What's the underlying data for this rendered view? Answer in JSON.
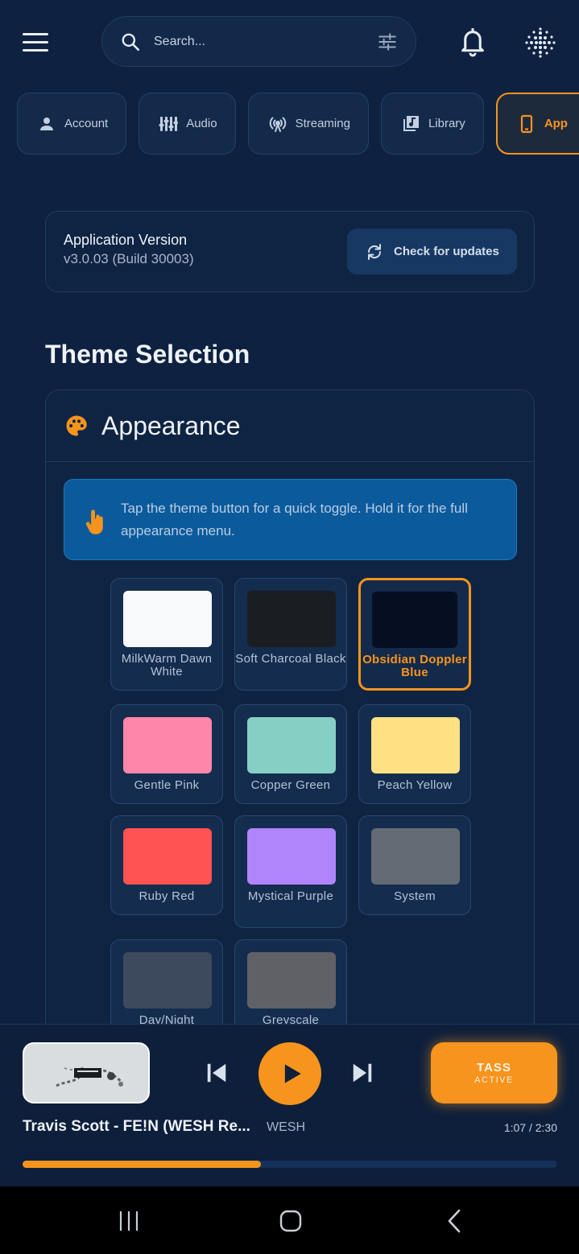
{
  "search": {
    "placeholder": "Search..."
  },
  "tabs": [
    {
      "label": "Account",
      "icon": "person-icon"
    },
    {
      "label": "Audio",
      "icon": "equalizer-icon"
    },
    {
      "label": "Streaming",
      "icon": "broadcast-icon"
    },
    {
      "label": "Library",
      "icon": "library-music-icon"
    },
    {
      "label": "App",
      "icon": "phone-icon",
      "active": true
    }
  ],
  "version": {
    "title": "Application Version",
    "subtitle": "v3.0.03 (Build 30003)",
    "update_label": "Check for updates"
  },
  "theme_section": {
    "title": "Theme Selection",
    "card_title": "Appearance",
    "hint": "Tap the theme button for a quick toggle. Hold it for the full appearance menu."
  },
  "themes": [
    {
      "label": "MilkWarm Dawn White",
      "color": "#f8f9fb"
    },
    {
      "label": "Soft Charcoal Black",
      "color": "#1a1d22"
    },
    {
      "label": "Obsidian Doppler Blue",
      "color": "#060e22",
      "selected": true
    },
    {
      "label": "Gentle Pink",
      "color": "#fe86ab"
    },
    {
      "label": "Copper Green",
      "color": "#86cfc5"
    },
    {
      "label": "Peach Yellow",
      "color": "#ffe184"
    },
    {
      "label": "Ruby Red",
      "color": "#fe5352"
    },
    {
      "label": "Mystical Purple",
      "color": "#b084fb"
    },
    {
      "label": "System",
      "color": "#646a74"
    },
    {
      "label": "Day/Night",
      "color": "#3d4a5e"
    },
    {
      "label": "Greyscale",
      "color": "#5f6166"
    }
  ],
  "player": {
    "track_title": "Travis Scott - FE!N (WESH Re...",
    "artist": "WESH",
    "time": "1:07 / 2:30",
    "progress": 0.446,
    "tass_label": "TASS",
    "tass_status": "ACTIVE"
  },
  "colors": {
    "accent": "#f7941d",
    "background": "#0e2140",
    "info": "#0b5a9c"
  }
}
